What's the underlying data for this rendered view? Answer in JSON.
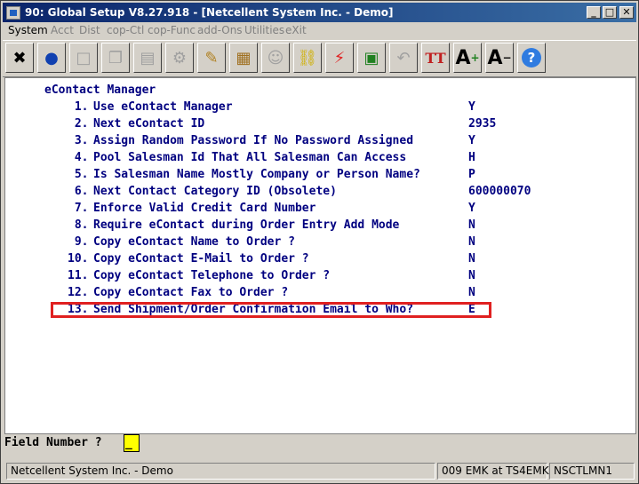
{
  "window": {
    "title": "90: Global Setup V8.27.918 - [Netcellent System Inc. - Demo]",
    "buttons": {
      "minimize": "_",
      "maximize": "□",
      "close": "✕"
    }
  },
  "menu": [
    "System",
    "Acct",
    "Dist",
    "cop-Ctl",
    "cop-Func",
    "add-Ons",
    "Utilities",
    "eXit"
  ],
  "toolbar": [
    "close-x",
    "globe",
    "blank",
    "copy",
    "paste",
    "settings",
    "edit",
    "notes",
    "users",
    "link",
    "lightning",
    "export",
    "undo",
    "font-tt",
    "font-increase",
    "font-decrease",
    "help"
  ],
  "screen": {
    "heading": "eContact Manager",
    "items": [
      {
        "num": " 1.",
        "label": "Use eContact Manager",
        "value": "Y"
      },
      {
        "num": " 2.",
        "label": "Next eContact ID",
        "value": "2935"
      },
      {
        "num": " 3.",
        "label": "Assign Random Password If No Password Assigned",
        "value": "Y"
      },
      {
        "num": " 4.",
        "label": "Pool Salesman Id That All Salesman Can Access",
        "value": "H"
      },
      {
        "num": " 5.",
        "label": "Is Salesman Name Mostly Company or Person Name?",
        "value": "P"
      },
      {
        "num": " 6.",
        "label": "Next Contact Category ID (Obsolete)",
        "value": "600000070"
      },
      {
        "num": " 7.",
        "label": "Enforce Valid Credit Card Number",
        "value": "Y"
      },
      {
        "num": " 8.",
        "label": "Require eContact during Order Entry Add Mode",
        "value": "N"
      },
      {
        "num": " 9.",
        "label": "Copy eContact Name to Order ?",
        "value": "N"
      },
      {
        "num": "10.",
        "label": "Copy eContact E-Mail to Order ?",
        "value": "N"
      },
      {
        "num": "11.",
        "label": "Copy eContact Telephone to Order ?",
        "value": "N"
      },
      {
        "num": "12.",
        "label": "Copy eContact Fax to Order ?",
        "value": "N"
      },
      {
        "num": "13.",
        "label": "Send Shipment/Order Confirmation Email to Who?",
        "value": "E"
      }
    ]
  },
  "field": {
    "label": "Field Number ?",
    "value": "_"
  },
  "status": {
    "company": "Netcellent System Inc. - Demo",
    "session": "009 EMK at TS4EMK",
    "terminal": "NSCTLMN1"
  },
  "colors": {
    "highlight_border": "#e02020",
    "input_bg": "#ffff00",
    "text": "#000080"
  }
}
